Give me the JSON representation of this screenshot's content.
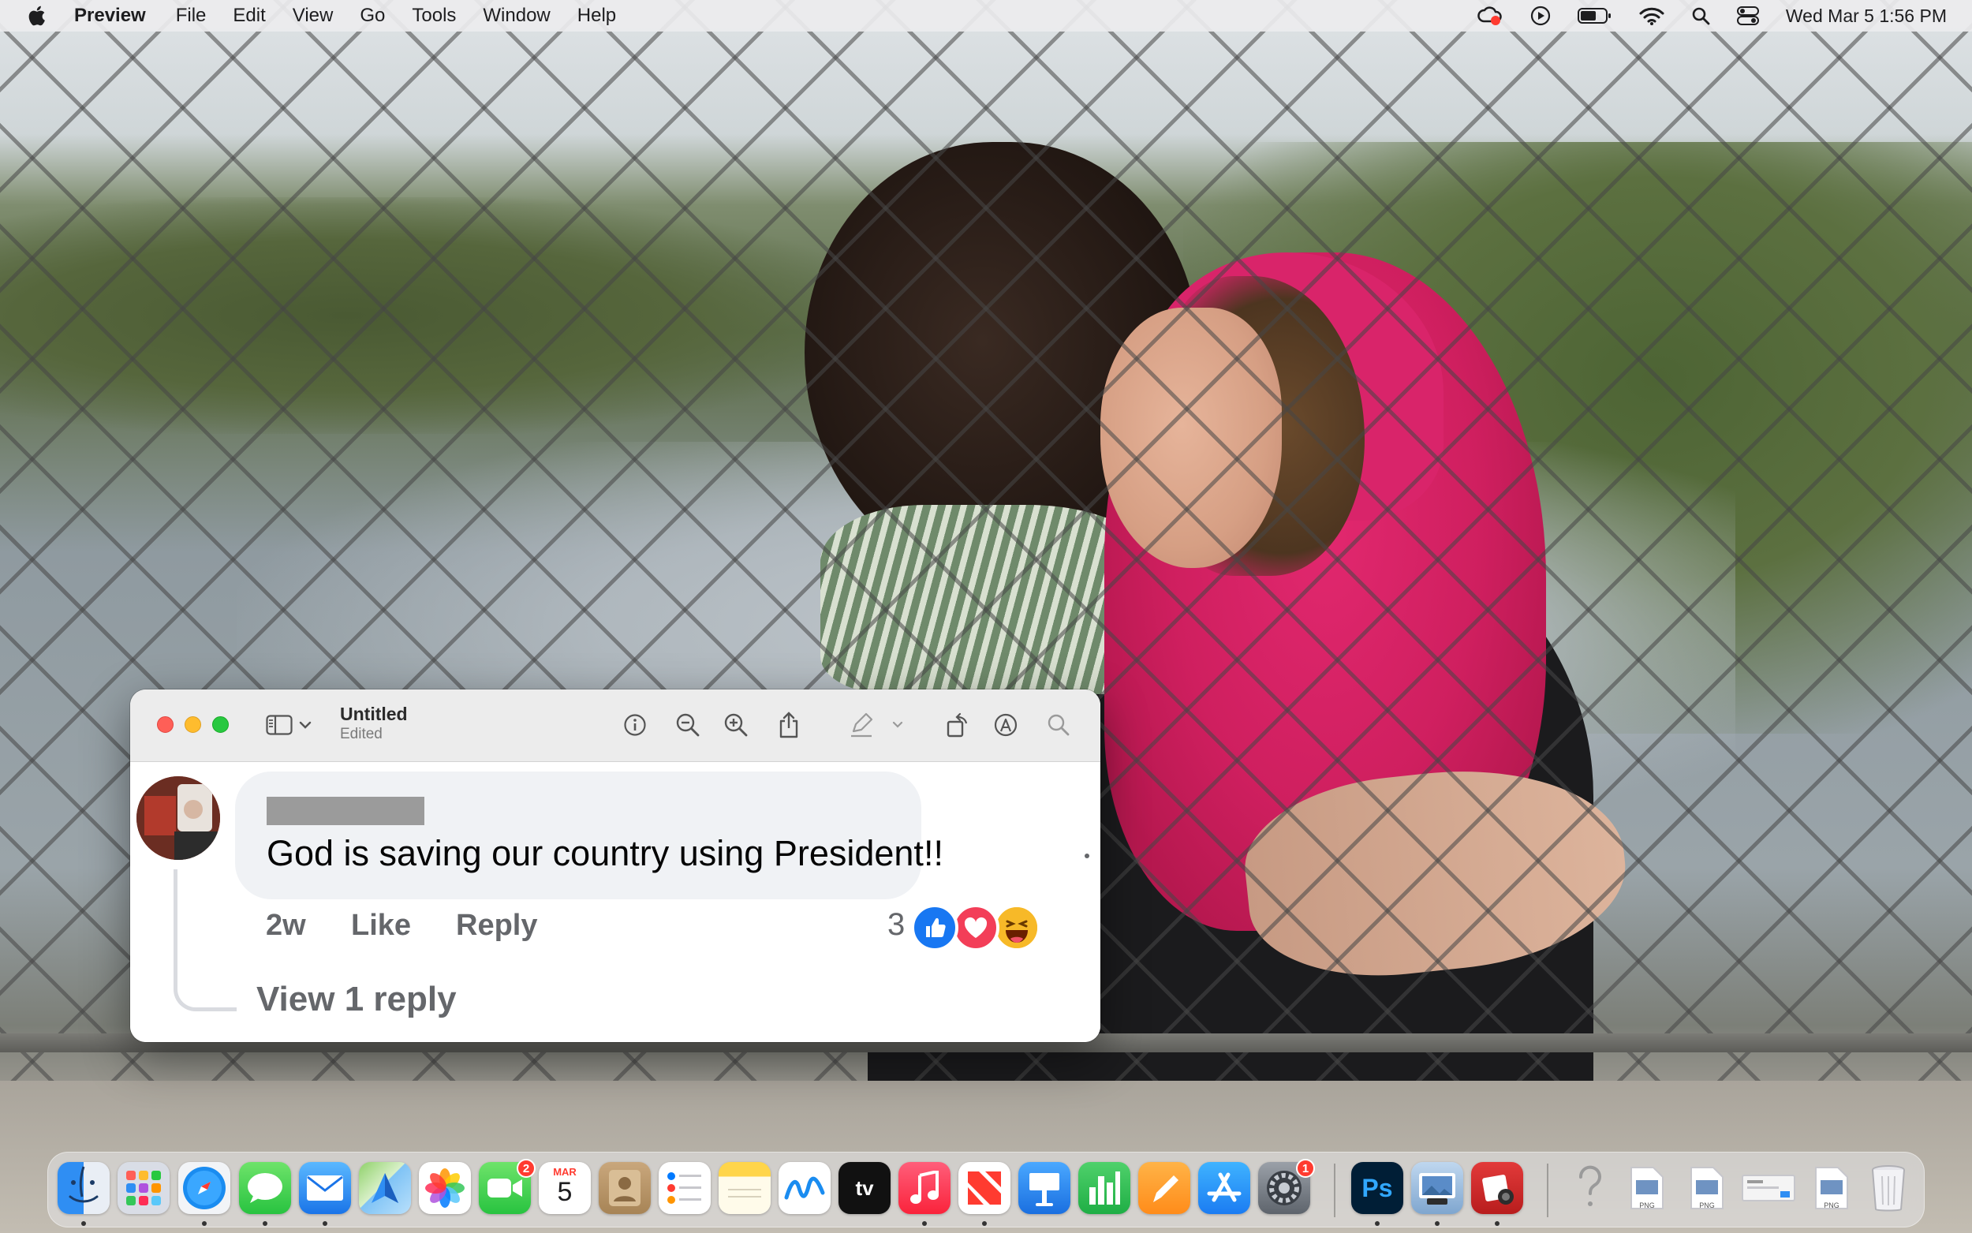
{
  "menubar": {
    "app_name": "Preview",
    "items": [
      "File",
      "Edit",
      "View",
      "Go",
      "Tools",
      "Window",
      "Help"
    ],
    "status_icons": [
      "creative-cloud-icon",
      "play-circle-icon",
      "battery-icon",
      "wifi-icon",
      "spotlight-search-icon",
      "control-center-icon"
    ],
    "clock": "Wed Mar 5  1:56 PM"
  },
  "window": {
    "title": "Untitled",
    "subtitle": "Edited",
    "toolbar_icons": [
      "sidebar-toggle-icon",
      "chevron-down-icon",
      "info-icon",
      "zoom-out-icon",
      "zoom-in-icon",
      "share-icon",
      "markup-pen-icon",
      "chevron-down-icon",
      "rotate-icon",
      "annotate-icon",
      "search-icon"
    ]
  },
  "comment": {
    "text": "God is saving our country using President!!",
    "time": "2w",
    "like_label": "Like",
    "reply_label": "Reply",
    "reaction_count": "3",
    "reactions": [
      "like",
      "love",
      "haha"
    ],
    "view_replies": "View 1 reply",
    "colors": {
      "like": "#1877f2",
      "love": "#f33e58",
      "haha": "#f7b928",
      "meta_text": "#65676b",
      "bubble": "#f0f2f5"
    }
  },
  "dock": {
    "apps": [
      {
        "name": "Finder",
        "icon": "finder-icon",
        "running": true
      },
      {
        "name": "Launchpad",
        "icon": "launchpad-icon",
        "running": false
      },
      {
        "name": "Safari",
        "icon": "safari-icon",
        "running": true
      },
      {
        "name": "Messages",
        "icon": "messages-icon",
        "running": true
      },
      {
        "name": "Mail",
        "icon": "mail-icon",
        "running": true
      },
      {
        "name": "Maps",
        "icon": "maps-icon",
        "running": false
      },
      {
        "name": "Photos",
        "icon": "photos-icon",
        "running": false
      },
      {
        "name": "FaceTime",
        "icon": "facetime-icon",
        "running": false,
        "badge": "2"
      },
      {
        "name": "Calendar",
        "icon": "calendar-icon",
        "running": false,
        "month": "MAR",
        "day": "5"
      },
      {
        "name": "Contacts",
        "icon": "contacts-icon",
        "running": false
      },
      {
        "name": "Reminders",
        "icon": "reminders-icon",
        "running": false
      },
      {
        "name": "Notes",
        "icon": "notes-icon",
        "running": false
      },
      {
        "name": "Freeform",
        "icon": "freeform-icon",
        "running": false
      },
      {
        "name": "TV",
        "icon": "apple-tv-icon",
        "running": false,
        "label": "tv"
      },
      {
        "name": "Music",
        "icon": "music-icon",
        "running": true
      },
      {
        "name": "News",
        "icon": "news-icon",
        "running": true
      },
      {
        "name": "Keynote",
        "icon": "keynote-icon",
        "running": false
      },
      {
        "name": "Numbers",
        "icon": "numbers-icon",
        "running": false
      },
      {
        "name": "Pages",
        "icon": "pages-icon",
        "running": false
      },
      {
        "name": "App Store",
        "icon": "app-store-icon",
        "running": false
      },
      {
        "name": "System Settings",
        "icon": "system-settings-icon",
        "running": false,
        "badge": "1"
      },
      {
        "name": "Photoshop",
        "icon": "photoshop-icon",
        "running": true,
        "label": "Ps"
      },
      {
        "name": "Preview",
        "icon": "preview-icon",
        "running": true
      },
      {
        "name": "Photo Booth",
        "icon": "photo-booth-icon",
        "running": true
      }
    ],
    "recents": [
      {
        "name": "Unknown",
        "icon": "question-mark-icon"
      },
      {
        "name": "PNG file",
        "icon": "png-file-icon",
        "label": "PNG"
      },
      {
        "name": "PNG file",
        "icon": "png-file-icon",
        "label": "PNG"
      },
      {
        "name": "Screenshot",
        "icon": "screenshot-thumbnail-icon"
      },
      {
        "name": "PNG file",
        "icon": "png-file-icon",
        "label": "PNG"
      },
      {
        "name": "Trash",
        "icon": "trash-icon"
      }
    ]
  }
}
